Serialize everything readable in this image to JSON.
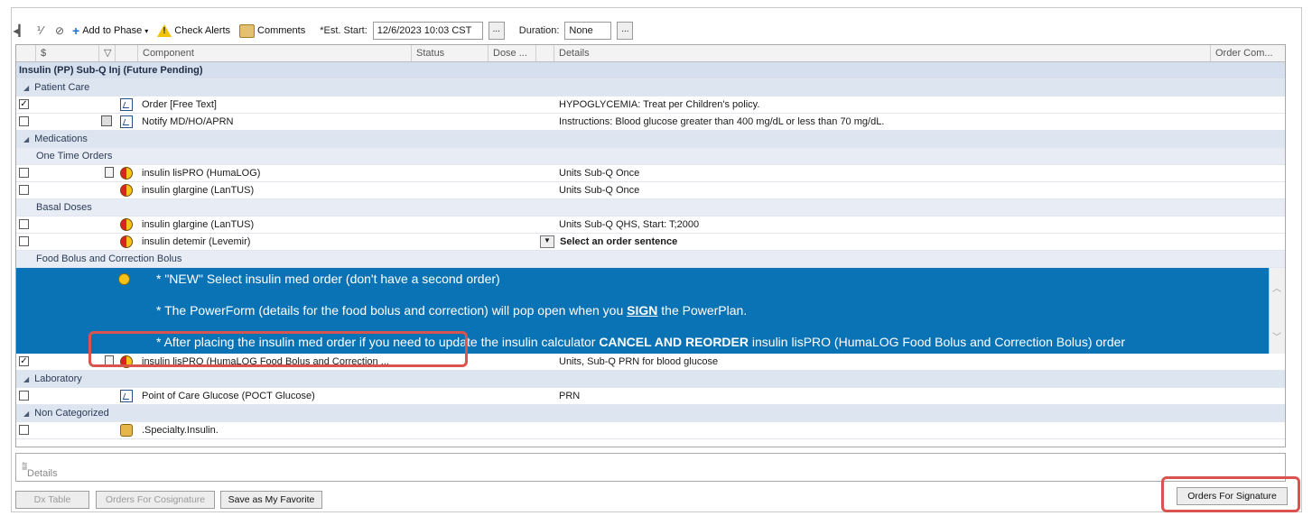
{
  "toolbar": {
    "add_to_phase": "Add to Phase",
    "check_alerts": "Check Alerts",
    "comments": "Comments",
    "est_start_label": "*Est. Start:",
    "est_start_value": "12/6/2023 10:03 CST",
    "duration_label": "Duration:",
    "duration_value": "None",
    "ellipsis": "..."
  },
  "columns": {
    "dollar": "$",
    "filter": "▽",
    "component": "Component",
    "status": "Status",
    "dose": "Dose ...",
    "details": "Details",
    "order_comments": "Order Com..."
  },
  "plan": {
    "title": "Insulin (PP) Sub-Q Inj (Future Pending)",
    "patient_care": "Patient Care",
    "order_free_text": "Order [Free Text]",
    "order_free_text_details": "HYPOGLYCEMIA: Treat per Children's policy.",
    "notify": "Notify MD/HO/APRN",
    "notify_details": "Instructions: Blood glucose greater than 400 mg/dL or less than 70 mg/dL.",
    "medications": "Medications",
    "one_time": "One Time Orders",
    "lispro": "insulin lisPRO (HumaLOG)",
    "lispro_details": "Units Sub-Q Once",
    "glargine": "insulin glargine (LanTUS)",
    "glargine_details": "Units Sub-Q Once",
    "basal": "Basal Doses",
    "glargine2": "insulin glargine (LanTUS)",
    "glargine2_details": "Units Sub-Q QHS, Start: T;2000",
    "detemir": "insulin detemir (Levemir)",
    "detemir_details": "Select an order sentence",
    "food_bolus": "Food Bolus and Correction Bolus",
    "banner_line1": "*  \"NEW\"  Select insulin med order (don't have a second order)",
    "banner_line2_a": "*  The PowerForm (details for the food bolus and correction) will pop open when you ",
    "banner_line2_b": "SIGN",
    "banner_line2_c": " the PowerPlan.",
    "banner_line3_a": "*  After placing the insulin med order if you need to update the insulin calculator ",
    "banner_line3_b": "CANCEL AND REORDER",
    "banner_line3_c": " insulin lisPRO (HumaLOG Food Bolus and Correction Bolus) order",
    "lispro_food": "insulin lisPRO (HumaLOG Food Bolus and Correction ...",
    "lispro_food_details": "Units, Sub-Q PRN for blood glucose",
    "laboratory": "Laboratory",
    "poct": "Point of Care Glucose (POCT Glucose)",
    "poct_details": "PRN",
    "non_categorized": "Non Categorized",
    "specialty": ".Specialty.Insulin."
  },
  "details_pane": {
    "label": "Details"
  },
  "footer": {
    "dx_table": "Dx Table",
    "orders_cosign": "Orders For Cosignature",
    "save_favorite": "Save as My Favorite",
    "orders_signature": "Orders For Signature"
  },
  "colors": {
    "banner": "#0a73b5",
    "highlight": "#d9534f",
    "group_row": "#d5dfee"
  }
}
